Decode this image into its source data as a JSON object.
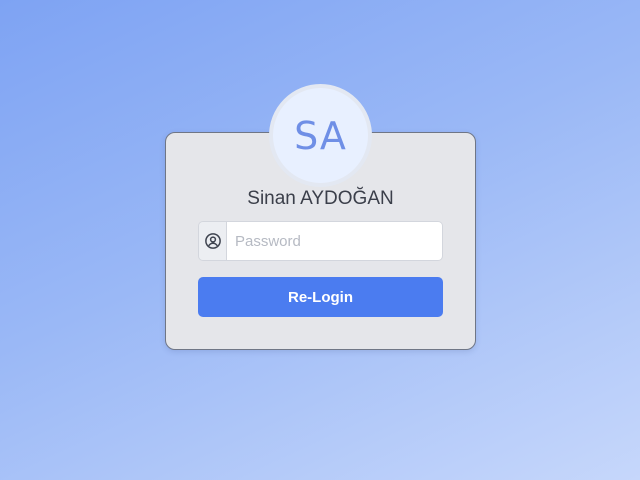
{
  "user": {
    "initials": "SA",
    "name": "Sinan AYDOĞAN"
  },
  "login_form": {
    "password_placeholder": "Password",
    "password_value": "",
    "prefix_icon": "user-circle-icon",
    "submit_label": "Re-Login"
  },
  "colors": {
    "background_gradient": [
      "#7ea3f3",
      "#c6d7fb"
    ],
    "card_background": "#e5e6ea",
    "accent": "#4b7cf0",
    "avatar_text": "#6f8fe6"
  }
}
